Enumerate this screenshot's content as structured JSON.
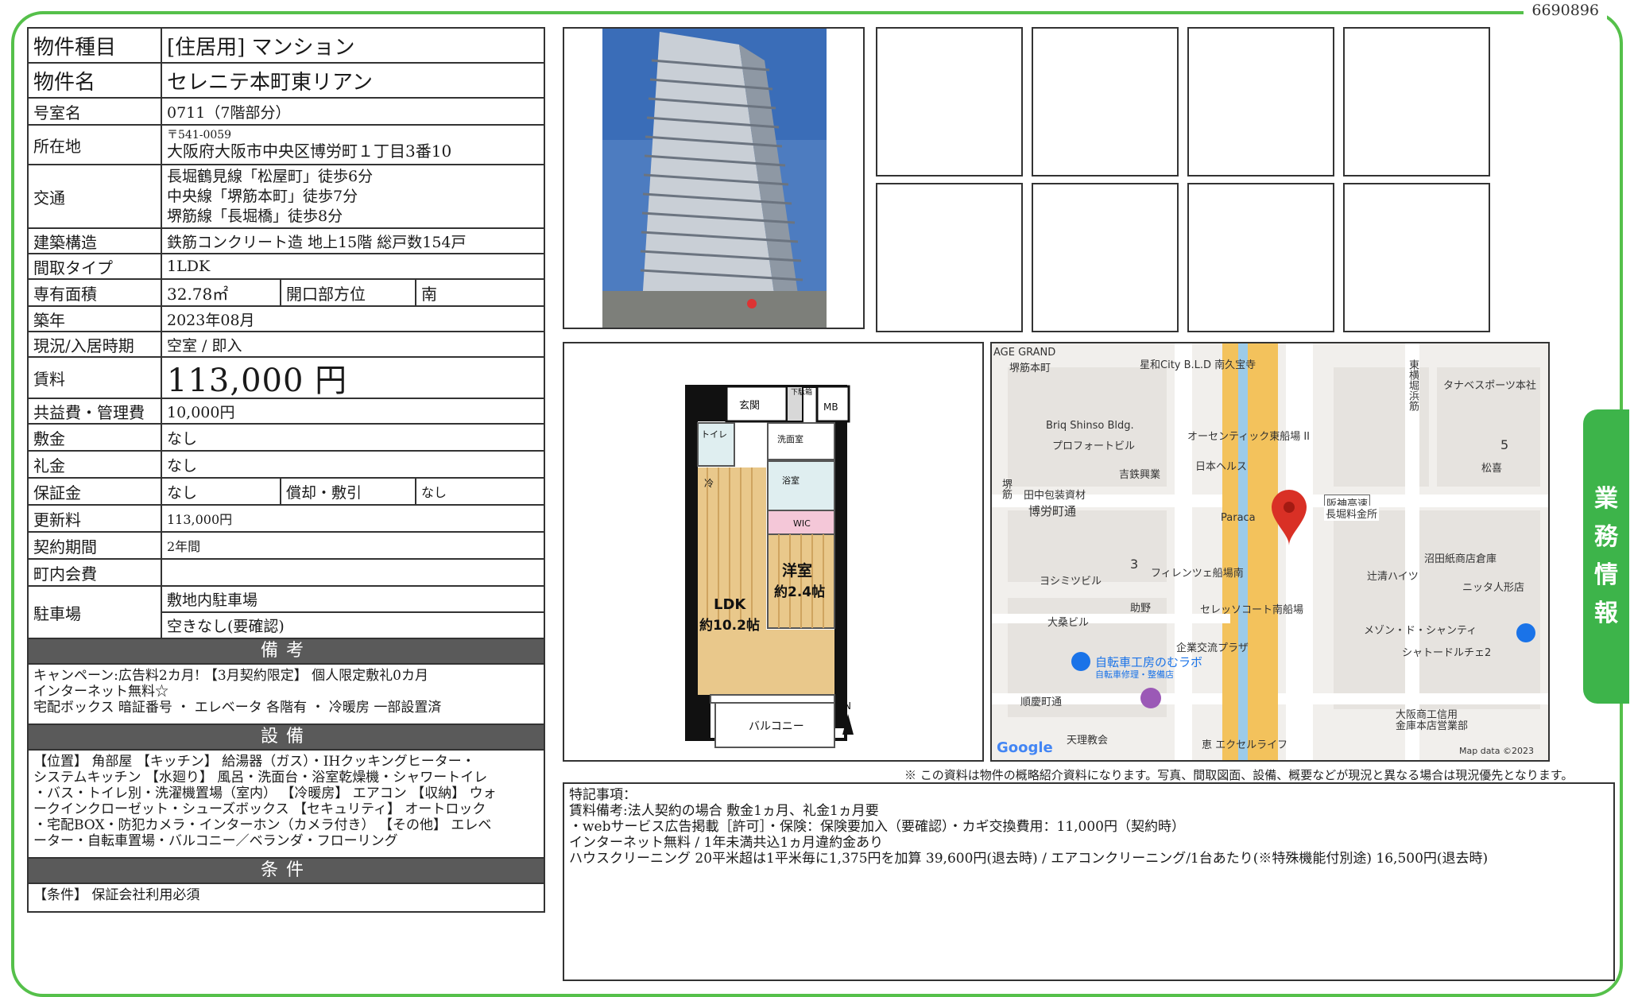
{
  "doc_id": "6690896",
  "side_tab": [
    "業",
    "務",
    "情",
    "報"
  ],
  "spec": {
    "type_label": "物件種目",
    "type_value": "[住居用]  マンション",
    "name_label": "物件名",
    "name_value": "セレニテ本町東リアン",
    "room_label": "号室名",
    "room_value": "0711（7階部分）",
    "address_label": "所在地",
    "postal": "〒541-0059",
    "address": "大阪府大阪市中央区博労町１丁目3番10",
    "access_label": "交通",
    "access": [
      "長堀鶴見線「松屋町」徒歩6分",
      "中央線「堺筋本町」徒歩7分",
      "堺筋線「長堀橋」徒歩8分"
    ],
    "structure_label": "建築構造",
    "structure_value": "鉄筋コンクリート造  地上15階  総戸数154戸",
    "layout_label": "間取タイプ",
    "layout_value": "1LDK",
    "area_label": "専有面積",
    "area_value": "32.78㎡",
    "direction_label": "開口部方位",
    "direction_value": "南",
    "built_label": "築年",
    "built_value": "2023年08月",
    "status_label": "現況/入居時期",
    "status_value": "空室  /  即入",
    "rent_label": "賃料",
    "rent_value": "113,000  円",
    "fee_label": "共益費・管理費",
    "fee_value": "10,000円",
    "deposit_label": "敷金",
    "deposit_value": "なし",
    "keymoney_label": "礼金",
    "keymoney_value": "なし",
    "guarantee_label": "保証金",
    "guarantee_value": "なし",
    "amort_label": "償却・敷引",
    "amort_value": "なし",
    "renewal_label": "更新料",
    "renewal_value": "113,000円",
    "contract_label": "契約期間",
    "contract_value": "2年間",
    "community_label": "町内会費",
    "community_value": "",
    "parking_label": "駐車場",
    "parking_value1": "敷地内駐車場",
    "parking_value2": "空きなし(要確認)"
  },
  "remarks": {
    "header": "備考",
    "lines": [
      "キャンペーン:広告料2カ月! 【3月契約限定】  個人限定敷礼0カ月",
      "インターネット無料☆",
      "宅配ボックス  暗証番号  ・  エレベータ  各階有  ・  冷暖房  一部設置済"
    ]
  },
  "equipment": {
    "header": "設備",
    "lines": [
      "【位置】  角部屋  【キッチン】  給湯器（ガス）・IHクッキングヒーター・",
      "システムキッチン  【水廻り】  風呂・洗面台・浴室乾燥機・シャワートイレ",
      "・バス・トイレ別・洗濯機置場（室内）  【冷暖房】  エアコン  【収納】  ウォ",
      "ークインクローゼット・シューズボックス  【セキュリティ】  オートロック",
      "・宅配BOX・防犯カメラ・インターホン（カメラ付き）  【その他】  エレベ",
      "ーター・自転車置場・バルコニー／ベランダ・フローリング"
    ]
  },
  "conditions": {
    "header": "条件",
    "lines": [
      "【条件】  保証会社利用必須"
    ]
  },
  "floorplan": {
    "entrance": "玄関",
    "shoebox": "下駄箱",
    "mb": "MB",
    "toilet": "トイレ",
    "washroom": "洗面室",
    "fridge": "冷",
    "bath": "浴室",
    "wic": "WIC",
    "youshitsu": "洋室",
    "youshitsu_size": "約2.4帖",
    "ldk": "LDK",
    "ldk_size": "約10.2帖",
    "balcony": "バルコニー",
    "north": "N"
  },
  "map": {
    "labels": [
      "AGE GRAND",
      "堺筋本町",
      "星和City B.L.D 南久宝寺",
      "東横堀浜筋",
      "タナベスポーツ本社",
      "Briq Shinso Bldg.",
      "オーセンティック東船場 II",
      "プロフォートビル",
      "5",
      "吉鉄興業",
      "日本ヘルス",
      "松喜",
      "田中包装資材",
      "阪神高速",
      "長堀料金所",
      "博労町通",
      "Paraca",
      "堺筋",
      "沼田紙商店倉庫",
      "3",
      "フィレンツェ船場南",
      "辻清ハイツ",
      "ヨシミツビル",
      "ニッタ人形店",
      "助野",
      "セレッソコート南船場",
      "大桑ビル",
      "メゾン・ド・シャンティ",
      "企業交流プラザ",
      "シャトードルチェ2",
      "自転車工房のむラボ",
      "自転車修理・整備店",
      "順慶町通",
      "大阪商工信用",
      "金庫本店営業部",
      "天理教会",
      "恵 エクセルライフ",
      "Google",
      "Map data ©2023"
    ]
  },
  "disclaimer": "※  この資料は物件の概略紹介資料になります。写真、間取図面、設備、概要などが現況と異なる場合は現況優先となります。",
  "notes": [
    "特記事項：",
    "賃料備考:法人契約の場合  敷金1ヵ月、礼金1ヵ月要",
    "・webサービス広告掲載［許可］・保険：保険要加入（要確認）・カギ交換費用：11,000円（契約時）",
    "インターネット無料  /  1年未満共込1ヵ月違約金あり",
    "ハウスクリーニング    20平米超は1平米毎に1,375円を加算  39,600円(退去時)  /  エアコンクリーニング/1台あたり(※特殊機能付別途)  16,500円(退去時)"
  ]
}
